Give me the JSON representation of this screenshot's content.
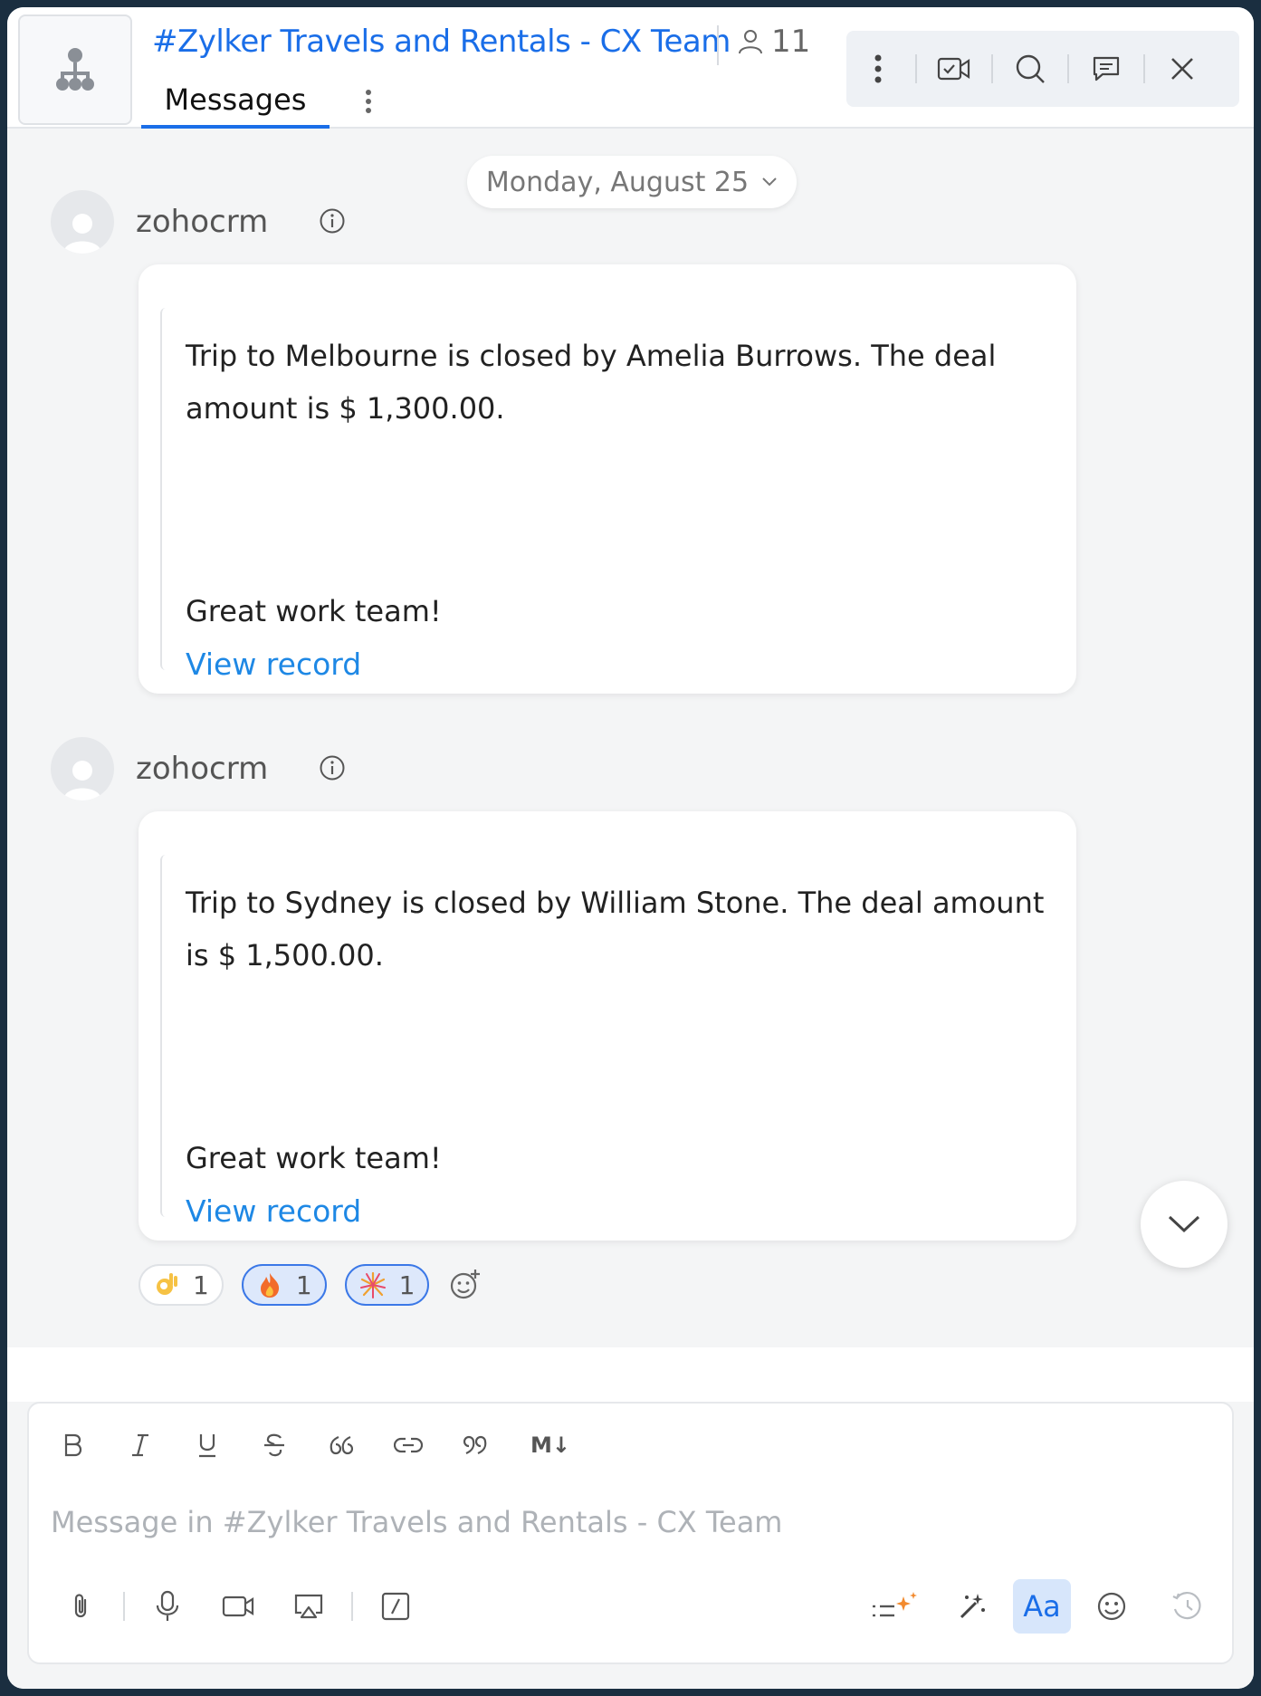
{
  "header": {
    "channel_title": "#Zylker Travels and Rentals - CX Team",
    "member_count": "11",
    "tab_label": "Messages"
  },
  "chat": {
    "date_label": "Monday, August 25",
    "messages": [
      {
        "sender": "zohocrm",
        "text": "Trip to Melbourne is closed by Amelia Burrows. The deal amount is $ 1,300.00.",
        "text2": "Great work team!",
        "link": "View record"
      },
      {
        "sender": "zohocrm",
        "text": "Trip to Sydney is closed by William Stone. The deal amount is $ 1,500.00.",
        "text2": "Great work team!",
        "link": "View record"
      }
    ],
    "reactions": [
      {
        "emoji": "ok-hand",
        "count": "1",
        "active": false
      },
      {
        "emoji": "fire",
        "count": "1",
        "active": true
      },
      {
        "emoji": "fireworks",
        "count": "1",
        "active": true
      }
    ]
  },
  "composer": {
    "placeholder": "Message in #Zylker Travels and Rentals - CX Team",
    "font_toggle_label": "Aa",
    "markdown_label": "M↓"
  },
  "colors": {
    "accent": "#1a6ee8",
    "link": "#1e88e5",
    "chat_bg": "#f4f5f6"
  }
}
